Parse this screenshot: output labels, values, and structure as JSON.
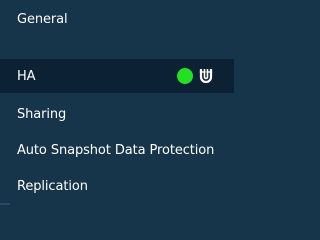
{
  "colors": {
    "background": "#16344a",
    "selected_background": "#0d2135",
    "text": "#ffffff",
    "status_ok": "#22e022"
  },
  "menu": {
    "items": [
      {
        "label": "General"
      },
      {
        "label": "HA",
        "selected": true,
        "status": "enabled",
        "status_icon": "green-dot-icon",
        "extra_icon": "magnet-icon"
      },
      {
        "label": "Sharing"
      },
      {
        "label": "Auto Snapshot Data Protection"
      },
      {
        "label": "Replication"
      }
    ]
  }
}
